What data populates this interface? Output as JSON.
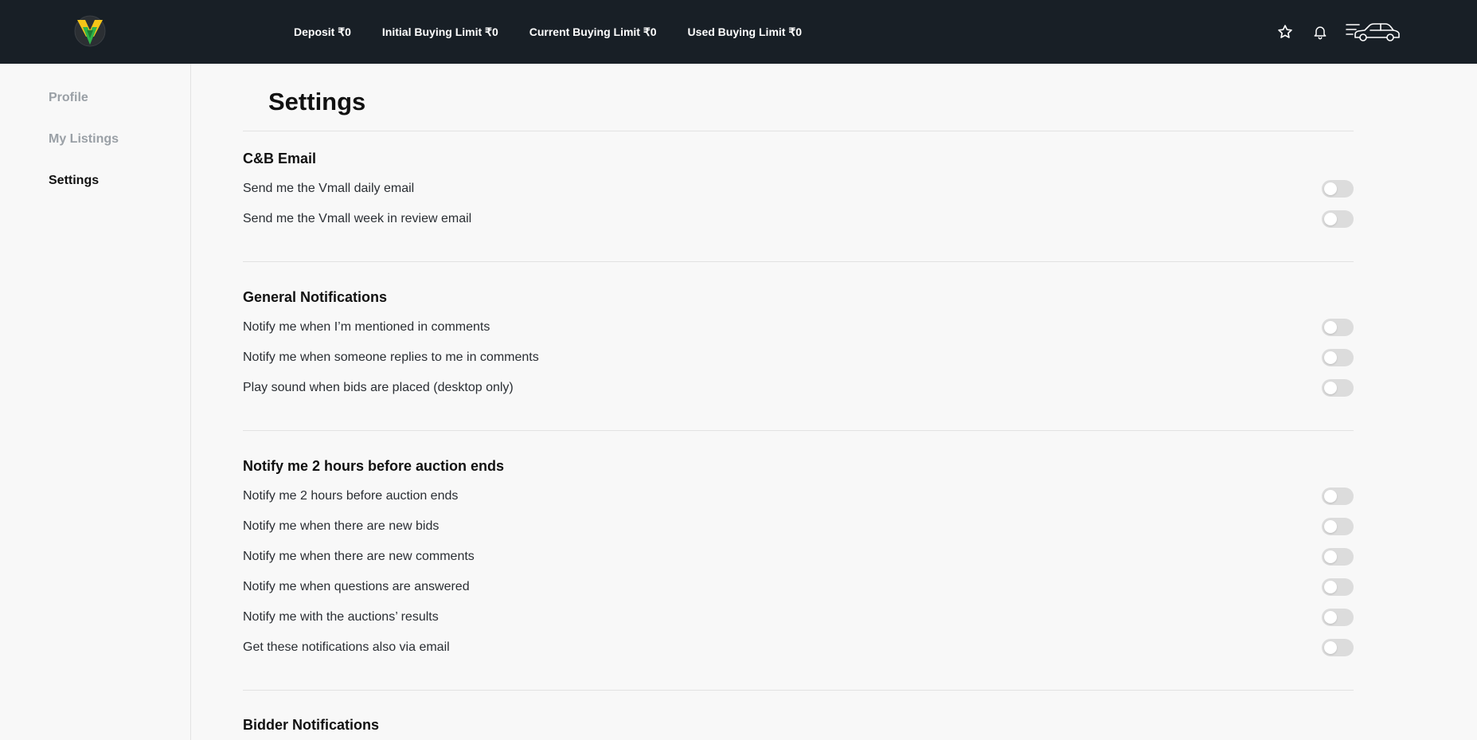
{
  "header": {
    "logo_icon": "vmall-logo",
    "limits": [
      {
        "label": "Deposit ₹0"
      },
      {
        "label": "Initial Buying Limit ₹0"
      },
      {
        "label": "Current Buying Limit ₹0"
      },
      {
        "label": "Used Buying Limit ₹0"
      }
    ],
    "icons": [
      "star-icon",
      "bell-icon",
      "menu-car-icon"
    ]
  },
  "sidebar": {
    "items": [
      {
        "label": "Profile",
        "active": false
      },
      {
        "label": "My Listings",
        "active": false
      },
      {
        "label": "Settings",
        "active": true
      }
    ]
  },
  "main": {
    "title": "Settings",
    "sections": [
      {
        "title": "C&B Email",
        "items": [
          {
            "label": "Send me the Vmall daily email",
            "enabled": false
          },
          {
            "label": "Send me the Vmall week in review email",
            "enabled": false
          }
        ]
      },
      {
        "title": "General Notifications",
        "items": [
          {
            "label": "Notify me when I’m mentioned in comments",
            "enabled": false
          },
          {
            "label": "Notify me when someone replies to me in comments",
            "enabled": false
          },
          {
            "label": "Play sound when bids are placed (desktop only)",
            "enabled": false
          }
        ]
      },
      {
        "title": "Notify me 2 hours before auction ends",
        "items": [
          {
            "label": "Notify me 2 hours before auction ends",
            "enabled": false
          },
          {
            "label": "Notify me when there are new bids",
            "enabled": false
          },
          {
            "label": "Notify me when there are new comments",
            "enabled": false
          },
          {
            "label": "Notify me when questions are answered",
            "enabled": false
          },
          {
            "label": "Notify me with the auctions’ results",
            "enabled": false
          },
          {
            "label": "Get these notifications also via email",
            "enabled": false
          }
        ]
      },
      {
        "title": "Bidder Notifications",
        "items": []
      }
    ]
  },
  "colors": {
    "header_bg": "#181f26",
    "page_bg": "#f8f8f8",
    "toggle_off": "#dcdcdc",
    "logo_yellow": "#f5c518",
    "logo_green": "#2fb34a"
  }
}
